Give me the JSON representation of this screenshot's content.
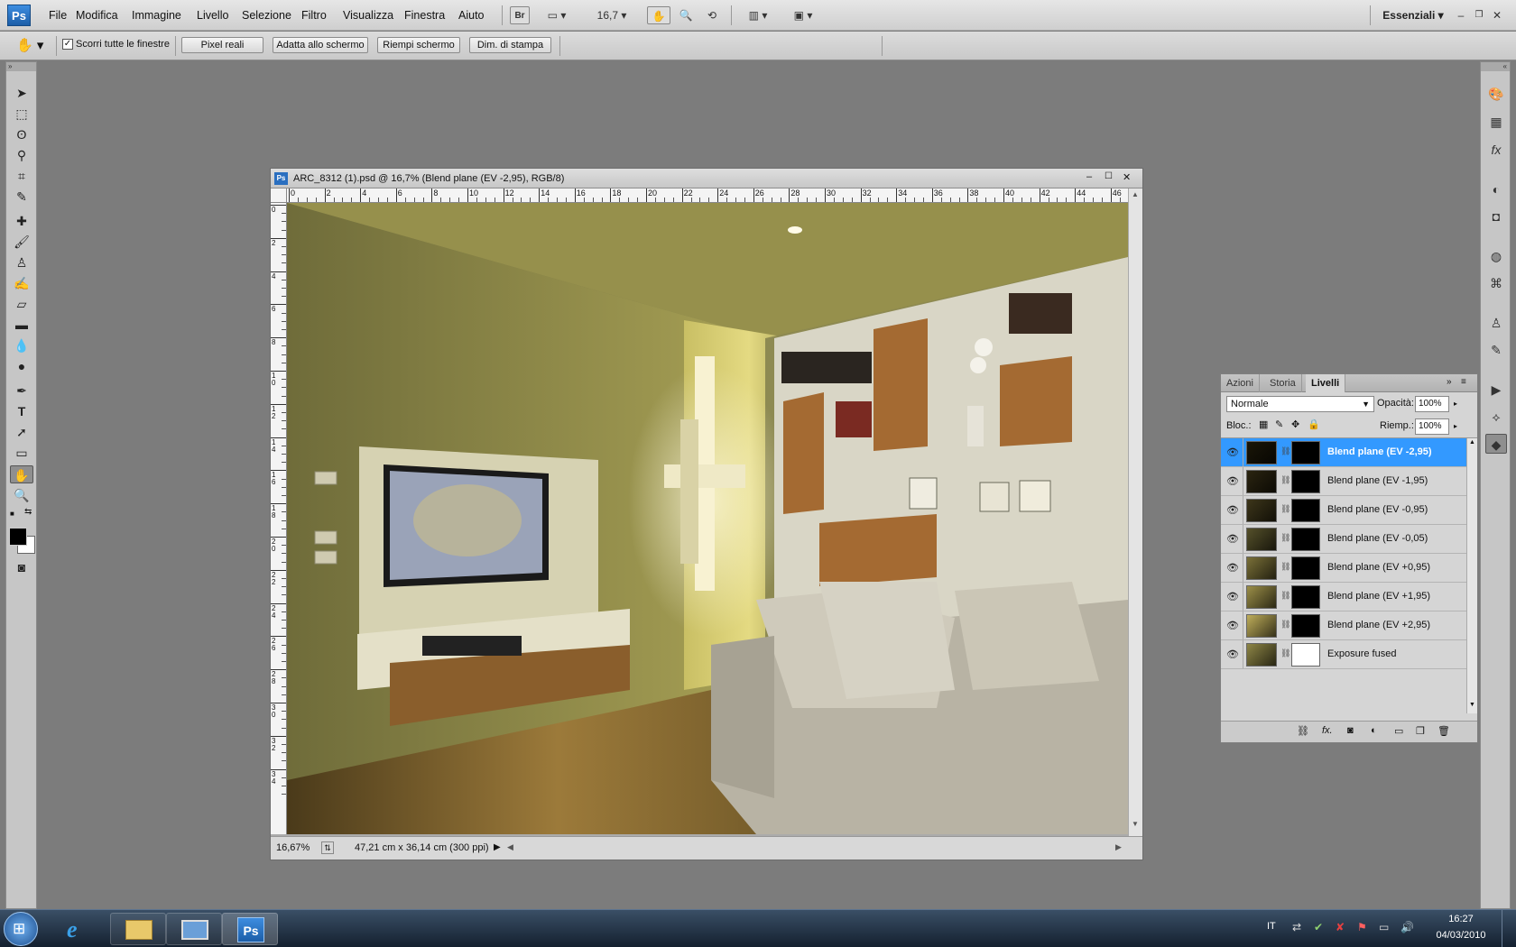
{
  "app": {
    "logo": "Ps"
  },
  "menu": [
    "File",
    "Modifica",
    "Immagine",
    "Livello",
    "Selezione",
    "Filtro",
    "Visualizza",
    "Finestra",
    "Aiuto"
  ],
  "menubar": {
    "bridge": "Br",
    "zoom": "16,7",
    "workspace": "Essenziali"
  },
  "options": {
    "scroll_all_label": "Scorri tutte le finestre",
    "scroll_all_checked": true,
    "buttons": [
      "Pixel reali",
      "Adatta allo schermo",
      "Riempi schermo",
      "Dim. di stampa"
    ]
  },
  "document": {
    "title": "ARC_8312 (1).psd @ 16,7% (Blend plane (EV -2,95), RGB/8)",
    "zoom": "16,67%",
    "info": "47,21 cm x 36,14 cm (300 ppi)",
    "hruler": [
      "0",
      "2",
      "4",
      "6",
      "8",
      "10",
      "12",
      "14",
      "16",
      "18",
      "20",
      "22",
      "24",
      "26",
      "28",
      "30",
      "32",
      "34",
      "36",
      "38",
      "40",
      "42",
      "44",
      "46"
    ],
    "vruler": [
      "0",
      "2",
      "4",
      "6",
      "8",
      "10",
      "12",
      "14",
      "16",
      "18",
      "20",
      "22",
      "24",
      "26",
      "28",
      "30",
      "32",
      "34"
    ]
  },
  "layers_panel": {
    "tabs": [
      "Azioni",
      "Storia",
      "Livelli"
    ],
    "active_tab": "Livelli",
    "blend_mode": "Normale",
    "opacity_label": "Opacità:",
    "opacity": "100%",
    "lock_label": "Bloc.:",
    "fill_label": "Riemp.:",
    "fill": "100%",
    "layers": [
      {
        "name": "Blend plane (EV -2,95)",
        "selected": true,
        "thumb": "#1a1608",
        "mask": "#000000"
      },
      {
        "name": "Blend plane (EV -1,95)",
        "selected": false,
        "thumb": "#2a2410",
        "mask": "#000000"
      },
      {
        "name": "Blend plane (EV -0,95)",
        "selected": false,
        "thumb": "#3d361a",
        "mask": "#000000"
      },
      {
        "name": "Blend plane (EV -0,05)",
        "selected": false,
        "thumb": "#55502a",
        "mask": "#000000"
      },
      {
        "name": "Blend plane (EV +0,95)",
        "selected": false,
        "thumb": "#7a7038",
        "mask": "#000000"
      },
      {
        "name": "Blend plane (EV +1,95)",
        "selected": false,
        "thumb": "#9c8f48",
        "mask": "#000000"
      },
      {
        "name": "Blend plane (EV +2,95)",
        "selected": false,
        "thumb": "#bfae5a",
        "mask": "#000000"
      },
      {
        "name": "Exposure fused",
        "selected": false,
        "thumb": "#8e8646",
        "mask": "#ffffff"
      }
    ]
  },
  "taskbar": {
    "lang": "IT",
    "time": "16:27",
    "date": "04/03/2010",
    "ps_label": "Ps"
  },
  "colors": {
    "accent": "#3399ff",
    "selected_layer": "#3399ff"
  }
}
